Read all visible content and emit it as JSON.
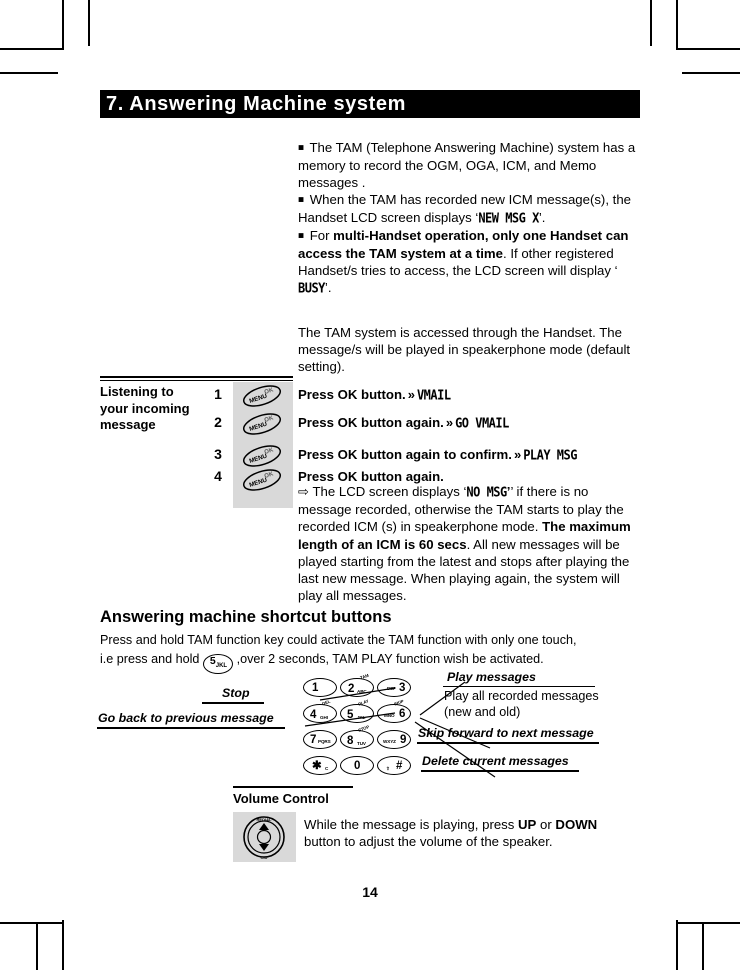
{
  "document": {
    "page_number": "14"
  },
  "chapter": {
    "title": "7. Answering Machine system"
  },
  "intro": {
    "bullet1_part1": "The TAM (Telephone Answering Machine) system has a memory to record the OGM, OGA, ICM, and Memo messages .",
    "bullet2_part1": "When the TAM has recorded new ICM message(s), the Handset LCD screen displays ‘",
    "bullet2_lcd": "NEW MSG X",
    "bullet2_part2": "’.",
    "bullet3_part1": "For ",
    "bullet3_bold": "multi-Handset operation, only one Handset can access the TAM system at a time",
    "bullet3_part2": ". If other registered Handset/s tries to access, the LCD screen will display ‘",
    "bullet3_lcd": "BUSY",
    "bullet3_part3": "’."
  },
  "access_paragraph": {
    "text": "The TAM system is accessed through the Handset. The message/s will be played in speakerphone mode (default setting)."
  },
  "procedure": {
    "title": "Listening to your incoming message",
    "button_label_top": "OK",
    "button_label_bottom": "MENU",
    "steps": [
      {
        "number": "1",
        "instruction": "Press OK button.",
        "arrow": "»",
        "lcd": "VMAIL"
      },
      {
        "number": "2",
        "instruction": "Press OK button again.",
        "arrow": "»",
        "lcd": "GO VMAIL"
      },
      {
        "number": "3",
        "instruction": "Press OK button again to confirm.",
        "arrow": "»",
        "lcd": "PLAY MSG"
      },
      {
        "number": "4",
        "instruction": "Press OK button again.",
        "arrow": "",
        "lcd": ""
      }
    ],
    "step4_marker": "⇨",
    "step4_part1": " The LCD screen displays ‘",
    "step4_lcd": "NO MSG",
    "step4_part2": "’ if there is no message recorded, otherwise the TAM starts to play the recorded ICM (s) in speakerphone mode. ",
    "step4_bold": "The maximum length of an ICM is 60 secs",
    "step4_part3": ". All new messages will be played starting from the latest and stops after playing the last new message. When playing again, the system will play all messages."
  },
  "shortcut": {
    "heading": "Answering machine shortcut buttons",
    "line1": "Press and hold TAM function key could activate the TAM function with only one touch,",
    "line2_pre": "i.e press and hold ",
    "key_number": "5",
    "key_sub": "JKL",
    "line2_post": " ,over 2 seconds, TAM PLAY function wish be activated."
  },
  "keypad": {
    "keys": [
      {
        "num": "1",
        "alpha": "",
        "top": ""
      },
      {
        "num": "2",
        "alpha": "ABC",
        "top": "TAM"
      },
      {
        "num": "3",
        "alpha": "DEF",
        "top": ""
      },
      {
        "num": "4",
        "alpha": "GHI",
        "top": "DEL"
      },
      {
        "num": "5",
        "alpha": "JKL",
        "top": "PLAY"
      },
      {
        "num": "6",
        "alpha": "MNO",
        "top": "SKIP"
      },
      {
        "num": "7",
        "alpha": "PQRS",
        "top": ""
      },
      {
        "num": "8",
        "alpha": "TUV",
        "top": "STOP"
      },
      {
        "num": "9",
        "alpha": "WXYZ",
        "top": ""
      },
      {
        "num": "✱",
        "alpha": "C",
        "top": ""
      },
      {
        "num": "0",
        "alpha": "",
        "top": ""
      },
      {
        "num": "#",
        "alpha": "⇧",
        "top": ""
      }
    ]
  },
  "callouts": {
    "stop": "Stop",
    "go_back": "Go back to previous message",
    "play_messages": "Play messages",
    "play_messages_desc": "Play all recorded messages (new and old)",
    "skip_forward": "Skip forward to next message",
    "delete_current": "Delete current messages"
  },
  "volume": {
    "title": "Volume Control",
    "nav_top_label": "REDIAL",
    "nav_bottom_label": "CID",
    "text_part1": "While the message is playing, press ",
    "text_up": "UP",
    "text_or": " or ",
    "text_down": "DOWN",
    "text_part2": " button to adjust the volume of the speaker."
  }
}
